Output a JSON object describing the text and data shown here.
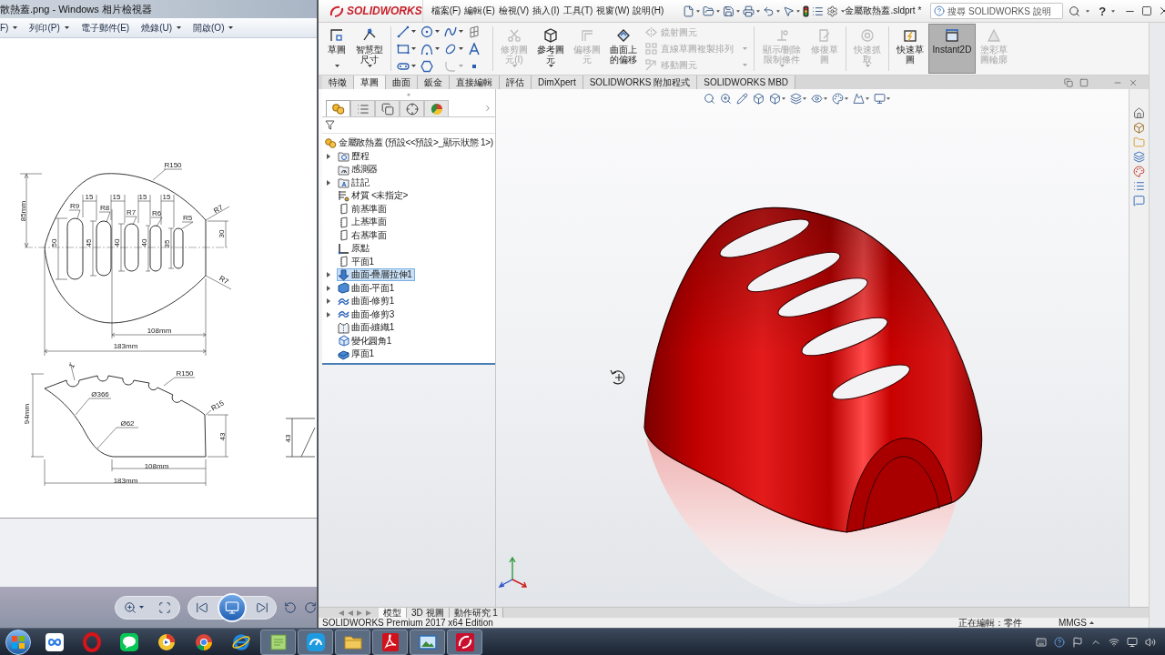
{
  "photo_viewer": {
    "title": "散熱蓋.png - Windows 相片檢視器",
    "menu": [
      {
        "label": "F)",
        "dropdown": true
      },
      {
        "label": "列印(P)",
        "dropdown": true
      },
      {
        "label": "電子郵件(E)",
        "dropdown": false
      },
      {
        "label": "燒錄(U)",
        "dropdown": true
      },
      {
        "label": "開啟(O)",
        "dropdown": true
      }
    ],
    "drawing": {
      "top_view_dimensions": [
        "R150",
        "85mm",
        "15",
        "15",
        "15",
        "15",
        "R9",
        "R8",
        "R7",
        "R6",
        "R5",
        "R7",
        "R7",
        "50",
        "45",
        "40",
        "40",
        "35",
        "30",
        "108mm",
        "183mm"
      ],
      "side_view_dimensions": [
        "1",
        "R150",
        "Ø366",
        "94mm",
        "Ø62",
        "R15",
        "43",
        "108mm",
        "183mm"
      ],
      "partial_view_dimensions": [
        "43"
      ]
    }
  },
  "solidworks": {
    "logo": "SOLIDWORKS",
    "menus": [
      "檔案(F)",
      "編輯(E)",
      "檢視(V)",
      "插入(I)",
      "工具(T)",
      "視窗(W)",
      "說明(H)"
    ],
    "document_title": "金屬散熱蓋.sldprt *",
    "search": {
      "placeholder": "搜尋 SOLIDWORKS 說明"
    },
    "help": "?",
    "ribbon": [
      {
        "kind": "large",
        "label": "草圖",
        "dropdown": true,
        "disabled": false,
        "selected": false
      },
      {
        "kind": "large",
        "label": "智慧型尺寸",
        "dropdown": true,
        "disabled": false,
        "selected": false
      },
      {
        "kind": "separator"
      },
      {
        "kind": "tools",
        "tools": [
          {
            "dropdown": true,
            "disabled": false
          },
          {
            "dropdown": true,
            "disabled": false
          },
          {
            "dropdown": true,
            "disabled": false
          },
          {
            "dropdown": false,
            "disabled": false
          },
          {
            "dropdown": true,
            "disabled": false
          },
          {
            "dropdown": true,
            "disabled": false
          },
          {
            "dropdown": true,
            "disabled": false
          },
          {
            "dropdown": false,
            "disabled": false
          },
          {
            "dropdown": true,
            "disabled": false
          },
          {
            "dropdown": false,
            "disabled": false
          },
          {
            "dropdown": true,
            "disabled": true
          },
          {
            "dropdown": false,
            "disabled": false
          }
        ]
      },
      {
        "kind": "separator"
      },
      {
        "kind": "large",
        "label": "修剪圖元(I)",
        "dropdown": true,
        "disabled": true,
        "selected": false
      },
      {
        "kind": "large",
        "label": "參考圖元",
        "dropdown": true,
        "disabled": false,
        "selected": false
      },
      {
        "kind": "large",
        "label": "偏移圖元",
        "dropdown": false,
        "disabled": true,
        "selected": false
      },
      {
        "kind": "large",
        "label": "曲面上的偏移",
        "dropdown": false,
        "disabled": false,
        "selected": false
      },
      {
        "kind": "stack",
        "items": [
          {
            "label": "鏡射圖元",
            "dropdown": false,
            "disabled": true
          },
          {
            "label": "直線草圖複製排列",
            "dropdown": true,
            "disabled": true
          },
          {
            "label": "移動圖元",
            "dropdown": true,
            "disabled": true
          }
        ]
      },
      {
        "kind": "separator"
      },
      {
        "kind": "large",
        "label": "顯示/刪除限制條件",
        "dropdown": true,
        "disabled": true,
        "selected": false
      },
      {
        "kind": "large",
        "label": "修復草圖",
        "dropdown": false,
        "disabled": true,
        "selected": false
      },
      {
        "kind": "separator"
      },
      {
        "kind": "large",
        "label": "快速抓取",
        "dropdown": true,
        "disabled": true,
        "selected": false
      },
      {
        "kind": "separator"
      },
      {
        "kind": "large",
        "label": "快速草圖",
        "dropdown": false,
        "disabled": false,
        "selected": false
      },
      {
        "kind": "large",
        "label": "Instant2D",
        "dropdown": false,
        "disabled": false,
        "selected": true
      },
      {
        "kind": "large",
        "label": "塗彩草圖輪廓",
        "dropdown": false,
        "disabled": true,
        "selected": false
      }
    ],
    "command_tabs": [
      {
        "label": "特徵",
        "selected": false
      },
      {
        "label": "草圖",
        "selected": true
      },
      {
        "label": "曲面",
        "selected": false
      },
      {
        "label": "鈑金",
        "selected": false
      },
      {
        "label": "直接編輯",
        "selected": false
      },
      {
        "label": "評估",
        "selected": false
      },
      {
        "label": "DimXpert",
        "selected": false
      },
      {
        "label": "SOLIDWORKS 附加程式",
        "selected": false
      },
      {
        "label": "SOLIDWORKS MBD",
        "selected": false
      }
    ],
    "feature_tree": {
      "panel_tabs": [
        {
          "selected": true
        },
        {
          "selected": false
        },
        {
          "selected": false
        },
        {
          "selected": false
        },
        {
          "selected": false
        }
      ],
      "root": {
        "label": "金屬散熱蓋 (預設<<預設>_顯示狀態 1>)",
        "selected": false,
        "children": [
          {
            "label": "歷程",
            "expandable": true,
            "selected": false
          },
          {
            "label": "感測器",
            "expandable": false,
            "selected": false
          },
          {
            "label": "註記",
            "expandable": true,
            "selected": false
          },
          {
            "label": "材質 <未指定>",
            "expandable": false,
            "selected": false
          },
          {
            "label": "前基準面",
            "expandable": false,
            "selected": false
          },
          {
            "label": "上基準面",
            "expandable": false,
            "selected": false
          },
          {
            "label": "右基準面",
            "expandable": false,
            "selected": false
          },
          {
            "label": "原點",
            "expandable": false,
            "selected": false
          },
          {
            "label": "平面1",
            "expandable": false,
            "selected": false
          },
          {
            "label": "曲面-疊層拉伸1",
            "expandable": true,
            "selected": true
          },
          {
            "label": "曲面-平面1",
            "expandable": true,
            "selected": false
          },
          {
            "label": "曲面-修剪1",
            "expandable": true,
            "selected": false
          },
          {
            "label": "曲面-修剪3",
            "expandable": true,
            "selected": false
          },
          {
            "label": "曲面-縫織1",
            "expandable": false,
            "selected": false
          },
          {
            "label": "變化圓角1",
            "expandable": false,
            "selected": false
          },
          {
            "label": "厚面1",
            "expandable": false,
            "selected": false
          }
        ]
      }
    },
    "model_tabs": [
      {
        "label": "模型",
        "selected": true
      },
      {
        "label": "3D 視圖",
        "selected": false
      },
      {
        "label": "動作研究 1",
        "selected": false
      }
    ],
    "status_bar": {
      "edition": "SOLIDWORKS Premium 2017 x64 Edition",
      "mode": "正在編輯：零件",
      "units": "MMGS"
    }
  },
  "taskbar": {
    "apps": [
      {
        "running": false
      },
      {
        "running": false
      },
      {
        "running": false
      },
      {
        "running": false
      },
      {
        "running": false
      },
      {
        "running": false
      },
      {
        "running": true
      },
      {
        "running": true
      },
      {
        "running": true
      },
      {
        "running": true
      },
      {
        "running": true
      },
      {
        "running": true
      }
    ]
  }
}
